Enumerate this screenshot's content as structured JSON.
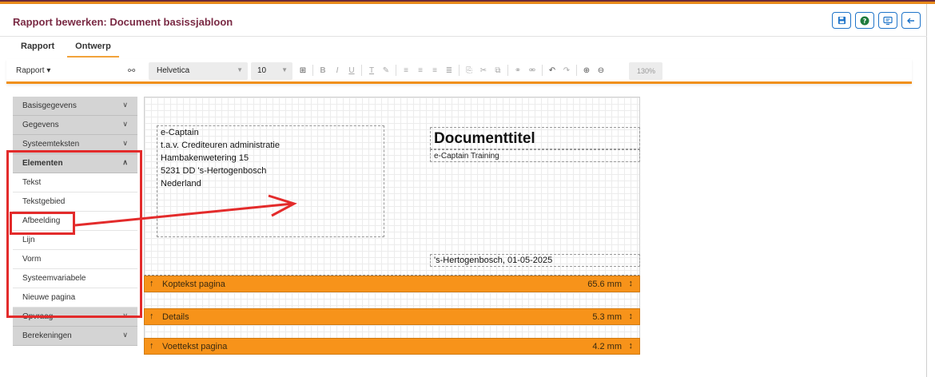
{
  "header": {
    "title": "Rapport bewerken: Document basissjabloon",
    "buttons": [
      {
        "name": "save",
        "icon": "floppy-icon"
      },
      {
        "name": "help",
        "icon": "question-icon"
      },
      {
        "name": "preview",
        "icon": "monitor-icon"
      },
      {
        "name": "back",
        "icon": "arrow-left-icon"
      }
    ]
  },
  "tabs": [
    {
      "label": "Rapport",
      "active": false
    },
    {
      "label": "Ontwerp",
      "active": true
    }
  ],
  "toolbar": {
    "rapport_menu": "Rapport ▾",
    "font": "Helvetica",
    "size": "10",
    "zoom": "130%"
  },
  "sidebar": {
    "sections": [
      {
        "label": "Basisgegevens",
        "expanded": false
      },
      {
        "label": "Gegevens",
        "expanded": false
      },
      {
        "label": "Systeemteksten",
        "expanded": false
      },
      {
        "label": "Elementen",
        "expanded": true,
        "items": [
          "Tekst",
          "Tekstgebied",
          "Afbeelding",
          "Lijn",
          "Vorm",
          "Systeemvariabele",
          "Nieuwe pagina"
        ]
      },
      {
        "label": "Opvraag",
        "expanded": false
      },
      {
        "label": "Berekeningen",
        "expanded": false
      }
    ]
  },
  "canvas": {
    "address": [
      "e-Captain",
      "t.a.v. Crediteuren administratie",
      "Hambakenwetering 15",
      "5231 DD 's-Hertogenbosch",
      "Nederland"
    ],
    "doc_title": "Documenttitel",
    "doc_subtitle": "e-Captain Training",
    "doc_date": "'s-Hertogenbosch, 01-05-2025"
  },
  "bands": [
    {
      "label": "Koptekst pagina",
      "value": "65.6 mm"
    },
    {
      "label": "Details",
      "value": "5.3 mm"
    },
    {
      "label": "Voettekst pagina",
      "value": "4.2 mm"
    }
  ],
  "colors": {
    "accent": "#f7931a",
    "title": "#7a2a44",
    "highlight": "#e32b2b",
    "button": "#1f74c9"
  }
}
